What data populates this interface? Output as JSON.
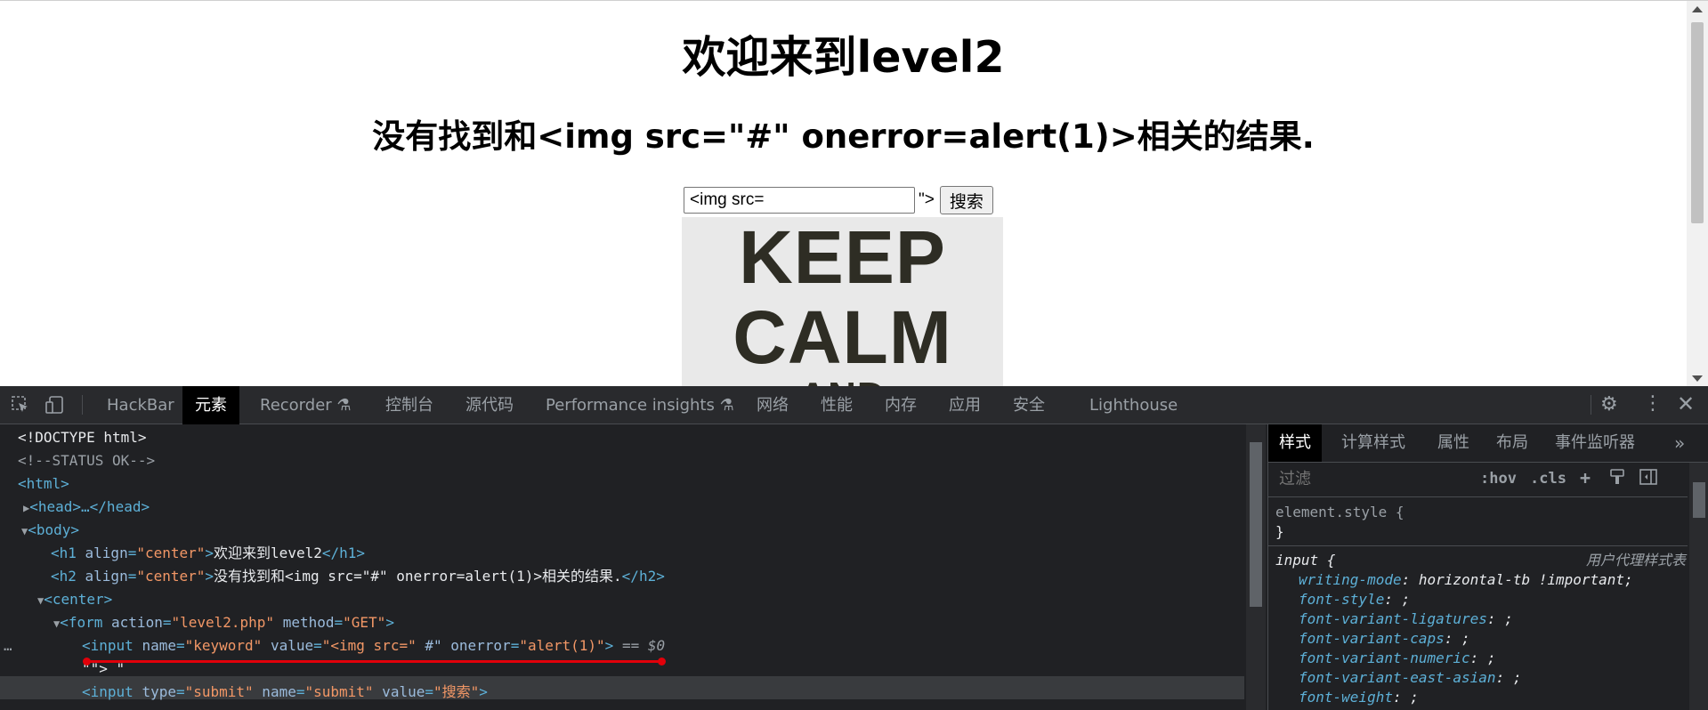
{
  "page": {
    "h1": "欢迎来到level2",
    "h2": "没有找到和<img src=\"#\" onerror=alert(1)>相关的结果.",
    "input_value": "<img src=",
    "after_input": "\">",
    "submit_label": "搜索",
    "poster": [
      "KEEP",
      "CALM",
      "AND"
    ]
  },
  "devtools": {
    "tabs": [
      "HackBar",
      "元素",
      "Recorder ⚗",
      "控制台",
      "源代码",
      "Performance insights ⚗",
      "网络",
      "性能",
      "内存",
      "应用",
      "安全",
      "Lighthouse"
    ],
    "active_tab": "元素",
    "styles_tabs": [
      "样式",
      "计算样式",
      "属性",
      "布局",
      "事件监听器"
    ],
    "filter_placeholder": "过滤",
    "hov": ":hov",
    "cls": ".cls",
    "element_style": "element.style {",
    "close_brace": "}",
    "rule_selector": "input {",
    "rule_source": "用户代理样式表",
    "props": [
      {
        "name": "writing-mode",
        "value": "horizontal-tb !important;"
      },
      {
        "name": "font-style",
        "value": ";"
      },
      {
        "name": "font-variant-ligatures",
        "value": ";"
      },
      {
        "name": "font-variant-caps",
        "value": ";"
      },
      {
        "name": "font-variant-numeric",
        "value": ";"
      },
      {
        "name": "font-variant-east-asian",
        "value": ";"
      },
      {
        "name": "font-weight",
        "value": ";"
      }
    ],
    "dom": {
      "doctype": "<!DOCTYPE html>",
      "comment": "<!--STATUS OK-->",
      "html": "<html>",
      "head": "<head>…</head>",
      "body": "<body>",
      "h1_text": "欢迎来到level2",
      "h2_text": "没有找到和<img src=\"#\" onerror=alert(1)>相关的结果.",
      "center": "<center>",
      "form_action": "\"level2.php\"",
      "form_method": "\"GET\"",
      "input_name": "\"keyword\"",
      "input_value": "\"<img src=\"",
      "input_extra_attr": "#\"",
      "input_onerror": "\"alert(1)\"",
      "selected_marker": "== $0",
      "text_node": "\"\"> \"",
      "submit_type": "\"submit\"",
      "submit_name": "\"submit\"",
      "submit_value": "\"搜索\""
    }
  }
}
